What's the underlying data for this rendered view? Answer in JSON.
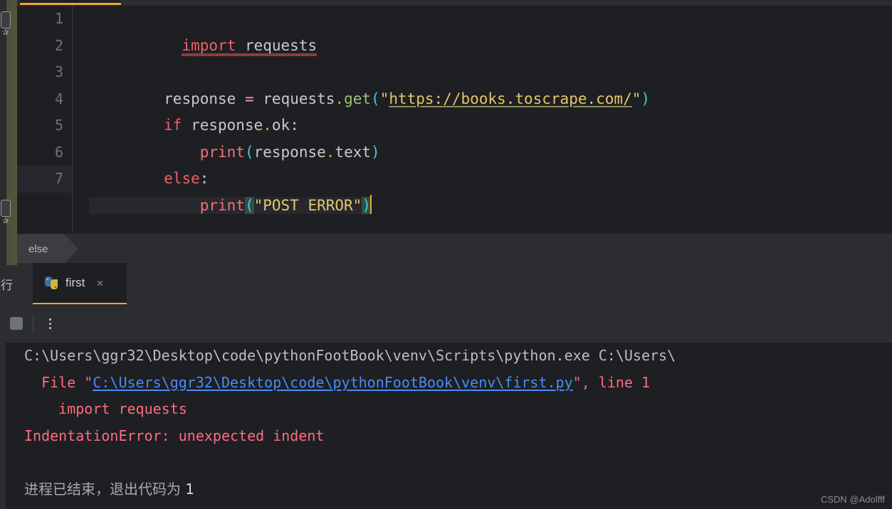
{
  "editor": {
    "accent_color": "#f0a732",
    "background": "#1e1f22",
    "lines": [
      {
        "num": "1",
        "text": " import requests"
      },
      {
        "num": "2",
        "text": ""
      },
      {
        "num": "3",
        "text": "response = requests.get(\"https://books.toscrape.com/\")"
      },
      {
        "num": "4",
        "text": "if response.ok:"
      },
      {
        "num": "5",
        "text": "    print(response.text)"
      },
      {
        "num": "6",
        "text": "else:"
      },
      {
        "num": "7",
        "text": "    print(\"POST ERROR\")"
      }
    ],
    "line1": {
      "kw": "import",
      "name": " requests"
    },
    "line3": {
      "var": "response",
      "op": "=",
      "module": "requests",
      "dot": ".",
      "method": "get",
      "open": "(",
      "quote": "\"",
      "url": "https://books.toscrape.com/",
      "close": ")"
    },
    "line4": {
      "kw": "if",
      "expr": " response",
      "dot": ".",
      "attr": "ok",
      "colon": ":"
    },
    "line5": {
      "fn": "print",
      "open": "(",
      "arg": "response",
      "dot": ".",
      "attr": "text",
      "close": ")"
    },
    "line6": {
      "kw": "else",
      "colon": ":"
    },
    "line7": {
      "fn": "print",
      "open": "(",
      "str": "\"POST ERROR\"",
      "close": ")"
    },
    "current_line": "7"
  },
  "breadcrumb": {
    "items": [
      "else"
    ]
  },
  "run_window": {
    "title": "运行",
    "tab_label": "first",
    "tab_icon": "python-file-icon",
    "close_label": "×"
  },
  "console_toolbar": {
    "stop_icon": "stop-square-icon",
    "more_icon": "kebab-menu-icon"
  },
  "console": {
    "line1": "C:\\Users\\ggr32\\Desktop\\code\\pythonFootBook\\venv\\Scripts\\python.exe C:\\Users\\",
    "line2_prefix": "  File ",
    "line2_quote_open": "\"",
    "line2_link": "C:\\Users\\ggr32\\Desktop\\code\\pythonFootBook\\venv\\first.py",
    "line2_quote_close": "\"",
    "line2_comma": ", ",
    "line2_tail": "line 1",
    "line3": "    import requests",
    "line4": "IndentationError: unexpected indent",
    "line5": "进程已结束，退出代码为 ",
    "line5_code": "1",
    "error_color": "#ff6b81",
    "link_color": "#4a8cf7"
  },
  "watermark": "CSDN @Adolfff"
}
